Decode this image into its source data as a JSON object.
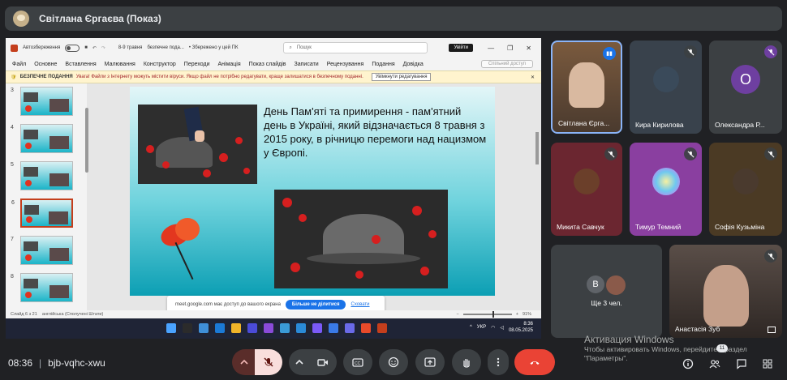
{
  "topbar": {
    "presenter": "Світлана Єргаєва (Показ)"
  },
  "powerpoint": {
    "title_bar": {
      "autosave": "Автозбереження",
      "filename": "8-9 травня",
      "protected": "безпечне пода...",
      "saved": "• Збережено у цей ПК",
      "search_placeholder": "Пошук",
      "signin": "Увійти"
    },
    "ribbon": [
      "Файл",
      "Основне",
      "Вставлення",
      "Малювання",
      "Конструктор",
      "Переходи",
      "Анімація",
      "Показ слайдів",
      "Записати",
      "Рецензування",
      "Подання",
      "Довідка"
    ],
    "share_label": "Спільний доступ",
    "infobar": {
      "title": "БЕЗПЕЧНЕ ПОДАННЯ",
      "message": "Увага! Файли з Інтернету можуть містити віруси. Якщо файл не потрібно редагувати, краще залишатися в безпечному поданні.",
      "button": "Увімкнути редагування"
    },
    "thumb_numbers": [
      "3",
      "4",
      "5",
      "6",
      "7",
      "8"
    ],
    "slide_text": "День Пам'яті та примирення - пам'ятний день в Україні, який відзначається 8 травня з 2015 року, в річницю перемоги над нацизмом у Європі.",
    "share_popup": {
      "text": "meet.google.com має доступ до вашого екрана",
      "stop": "Більше не ділитися",
      "hide": "Сховати"
    },
    "status": {
      "slide": "Слайд 6 з 21",
      "language": "англійська (Сполучені Штати)",
      "zoom": "91%"
    },
    "taskbar": {
      "lang": "УКР",
      "time": "8:36",
      "date": "08.05.2025"
    }
  },
  "participants": [
    {
      "name": "Світлана Єрга...",
      "type": "video"
    },
    {
      "name": "Кира Кирилова",
      "type": "avatar"
    },
    {
      "name": "Олександра Р...",
      "type": "initial",
      "initial": "О"
    },
    {
      "name": "Микита Савчук",
      "type": "avatar"
    },
    {
      "name": "Тимур Темний",
      "type": "avatar"
    },
    {
      "name": "Софія Кузьміна",
      "type": "avatar"
    },
    {
      "name": "Ще 3 чел.",
      "type": "group",
      "initial": "В"
    },
    {
      "name": "Анастасія Зуб",
      "type": "video"
    }
  ],
  "bottom": {
    "time": "08:36",
    "code": "bjb-vqhc-xwu",
    "people_count": "11"
  },
  "activation": {
    "title": "Активация Windows",
    "text": "Чтобы активировать Windows, перейдите в раздел \"Параметры\"."
  },
  "colors": {
    "hangup": "#ea4335",
    "mic_off_bg": "#f9dedc",
    "accent": "#1a73e8"
  }
}
